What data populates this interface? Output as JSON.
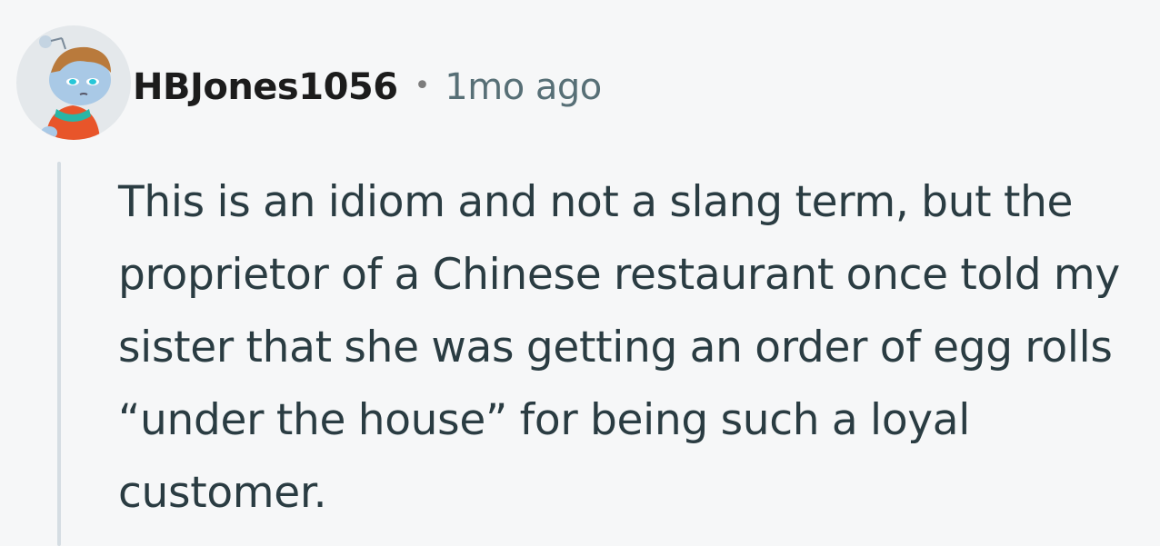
{
  "comment": {
    "author": "HBJones1056",
    "separator": "•",
    "timestamp": "1mo ago",
    "avatar_icon": "snoo-avatar-icon",
    "body": "This is an idiom and not a slang term, but the proprietor of a Chinese restaurant once told my sister that she was getting an order of egg rolls “under the house” for being such a loyal customer."
  },
  "colors": {
    "background": "#f6f7f8",
    "thread_line": "#d5dde3",
    "timestamp": "#576f76",
    "body_text": "#2a3c42"
  }
}
